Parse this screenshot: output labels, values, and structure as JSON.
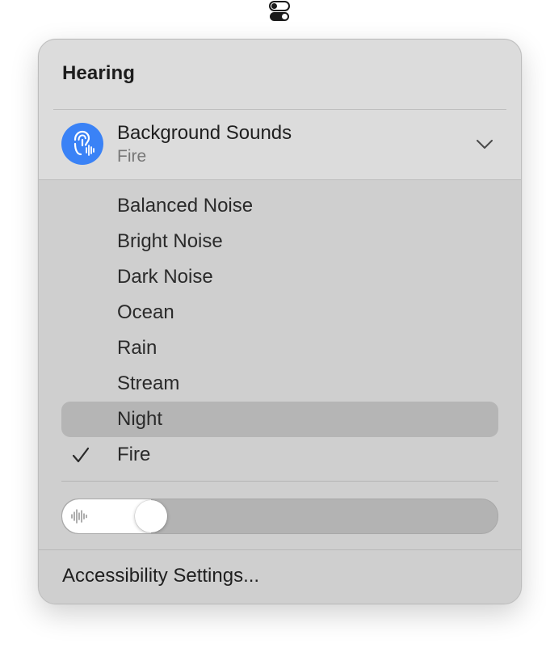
{
  "menubar": {
    "icon": "control-center-toggles-icon"
  },
  "panel": {
    "title": "Hearing",
    "background_sounds": {
      "icon": "ear-soundwave-icon",
      "title": "Background Sounds",
      "current": "Fire",
      "expanded_icon": "chevron-down-icon"
    },
    "options": [
      {
        "label": "Balanced Noise",
        "checked": false,
        "highlighted": false
      },
      {
        "label": "Bright Noise",
        "checked": false,
        "highlighted": false
      },
      {
        "label": "Dark Noise",
        "checked": false,
        "highlighted": false
      },
      {
        "label": "Ocean",
        "checked": false,
        "highlighted": false
      },
      {
        "label": "Rain",
        "checked": false,
        "highlighted": false
      },
      {
        "label": "Stream",
        "checked": false,
        "highlighted": false
      },
      {
        "label": "Night",
        "checked": false,
        "highlighted": true
      },
      {
        "label": "Fire",
        "checked": true,
        "highlighted": false
      }
    ],
    "volume": {
      "icon": "soundwave-icon",
      "level": 0.18
    },
    "footer_link": "Accessibility Settings..."
  },
  "colors": {
    "accent": "#3a82f6",
    "panel_bg": "#dcdcdc",
    "submenu_bg": "#cfcfcf",
    "highlight": "#b5b5b5"
  }
}
